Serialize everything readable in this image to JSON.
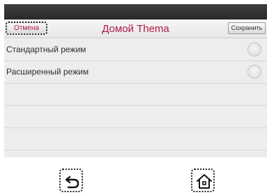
{
  "header": {
    "cancel_label": "Отмена",
    "title": "Домой Thema",
    "save_label": "Сохранить"
  },
  "options": [
    {
      "label": "Стандартный режим",
      "selected": false
    },
    {
      "label": "Расширенный режим",
      "selected": false
    }
  ],
  "nav": {
    "back_icon": "back-arrow-icon",
    "home_icon": "home-icon"
  },
  "colors": {
    "accent": "#b01a45",
    "status_bar": "#333333",
    "background": "#ededed"
  }
}
